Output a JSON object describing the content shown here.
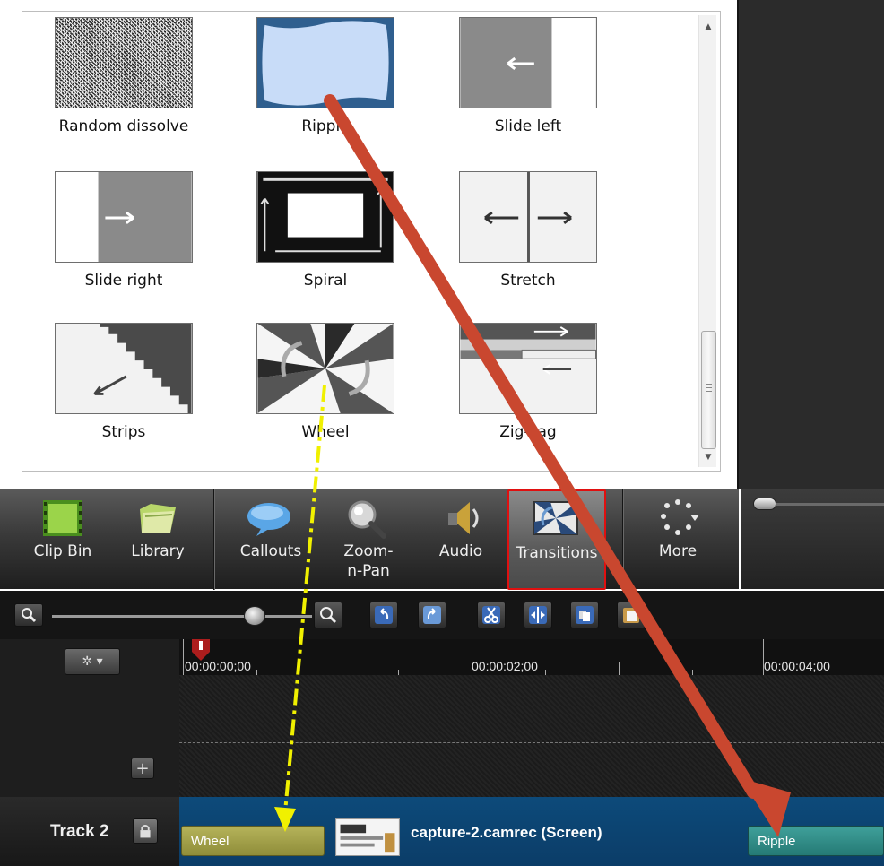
{
  "gallery": {
    "items": [
      {
        "label": "Random dissolve",
        "icon": "random-dissolve-thumbnail"
      },
      {
        "label": "Ripple",
        "icon": "ripple-thumbnail"
      },
      {
        "label": "Slide left",
        "icon": "slide-left-thumbnail"
      },
      {
        "label": "Slide right",
        "icon": "slide-right-thumbnail"
      },
      {
        "label": "Spiral",
        "icon": "spiral-thumbnail"
      },
      {
        "label": "Stretch",
        "icon": "stretch-thumbnail"
      },
      {
        "label": "Strips",
        "icon": "strips-thumbnail"
      },
      {
        "label": "Wheel",
        "icon": "wheel-thumbnail"
      },
      {
        "label": "Zig-zag",
        "icon": "zig-zag-thumbnail"
      }
    ]
  },
  "tasks": {
    "items": [
      {
        "label": "Clip Bin",
        "icon": "film-strip-icon"
      },
      {
        "label": "Library",
        "icon": "folder-icon"
      },
      {
        "label": "Callouts",
        "icon": "speech-bubble-icon"
      },
      {
        "label": "Zoom-n-Pan",
        "icon": "magnifier-icon"
      },
      {
        "label": "Audio",
        "icon": "speaker-icon"
      },
      {
        "label": "Transitions",
        "icon": "transitions-icon"
      },
      {
        "label": "More",
        "icon": "more-dots-icon"
      }
    ],
    "selected": "Transitions"
  },
  "timeline": {
    "ruler": [
      "00:00:00;00",
      "00:00:02;00",
      "00:00:04;00"
    ],
    "track_name": "Track 2",
    "clips": {
      "wheel": "Wheel",
      "media": "capture-2.camrec (Screen)",
      "ripple": "Ripple"
    }
  },
  "colors": {
    "selection_outline": "#e01010",
    "red_arrow": "#c9472f",
    "yellow_arrow": "#f0f000",
    "track_lane": "#0d4a7a",
    "wheel_chip": "#a8a64a",
    "ripple_chip": "#2f8e89"
  }
}
